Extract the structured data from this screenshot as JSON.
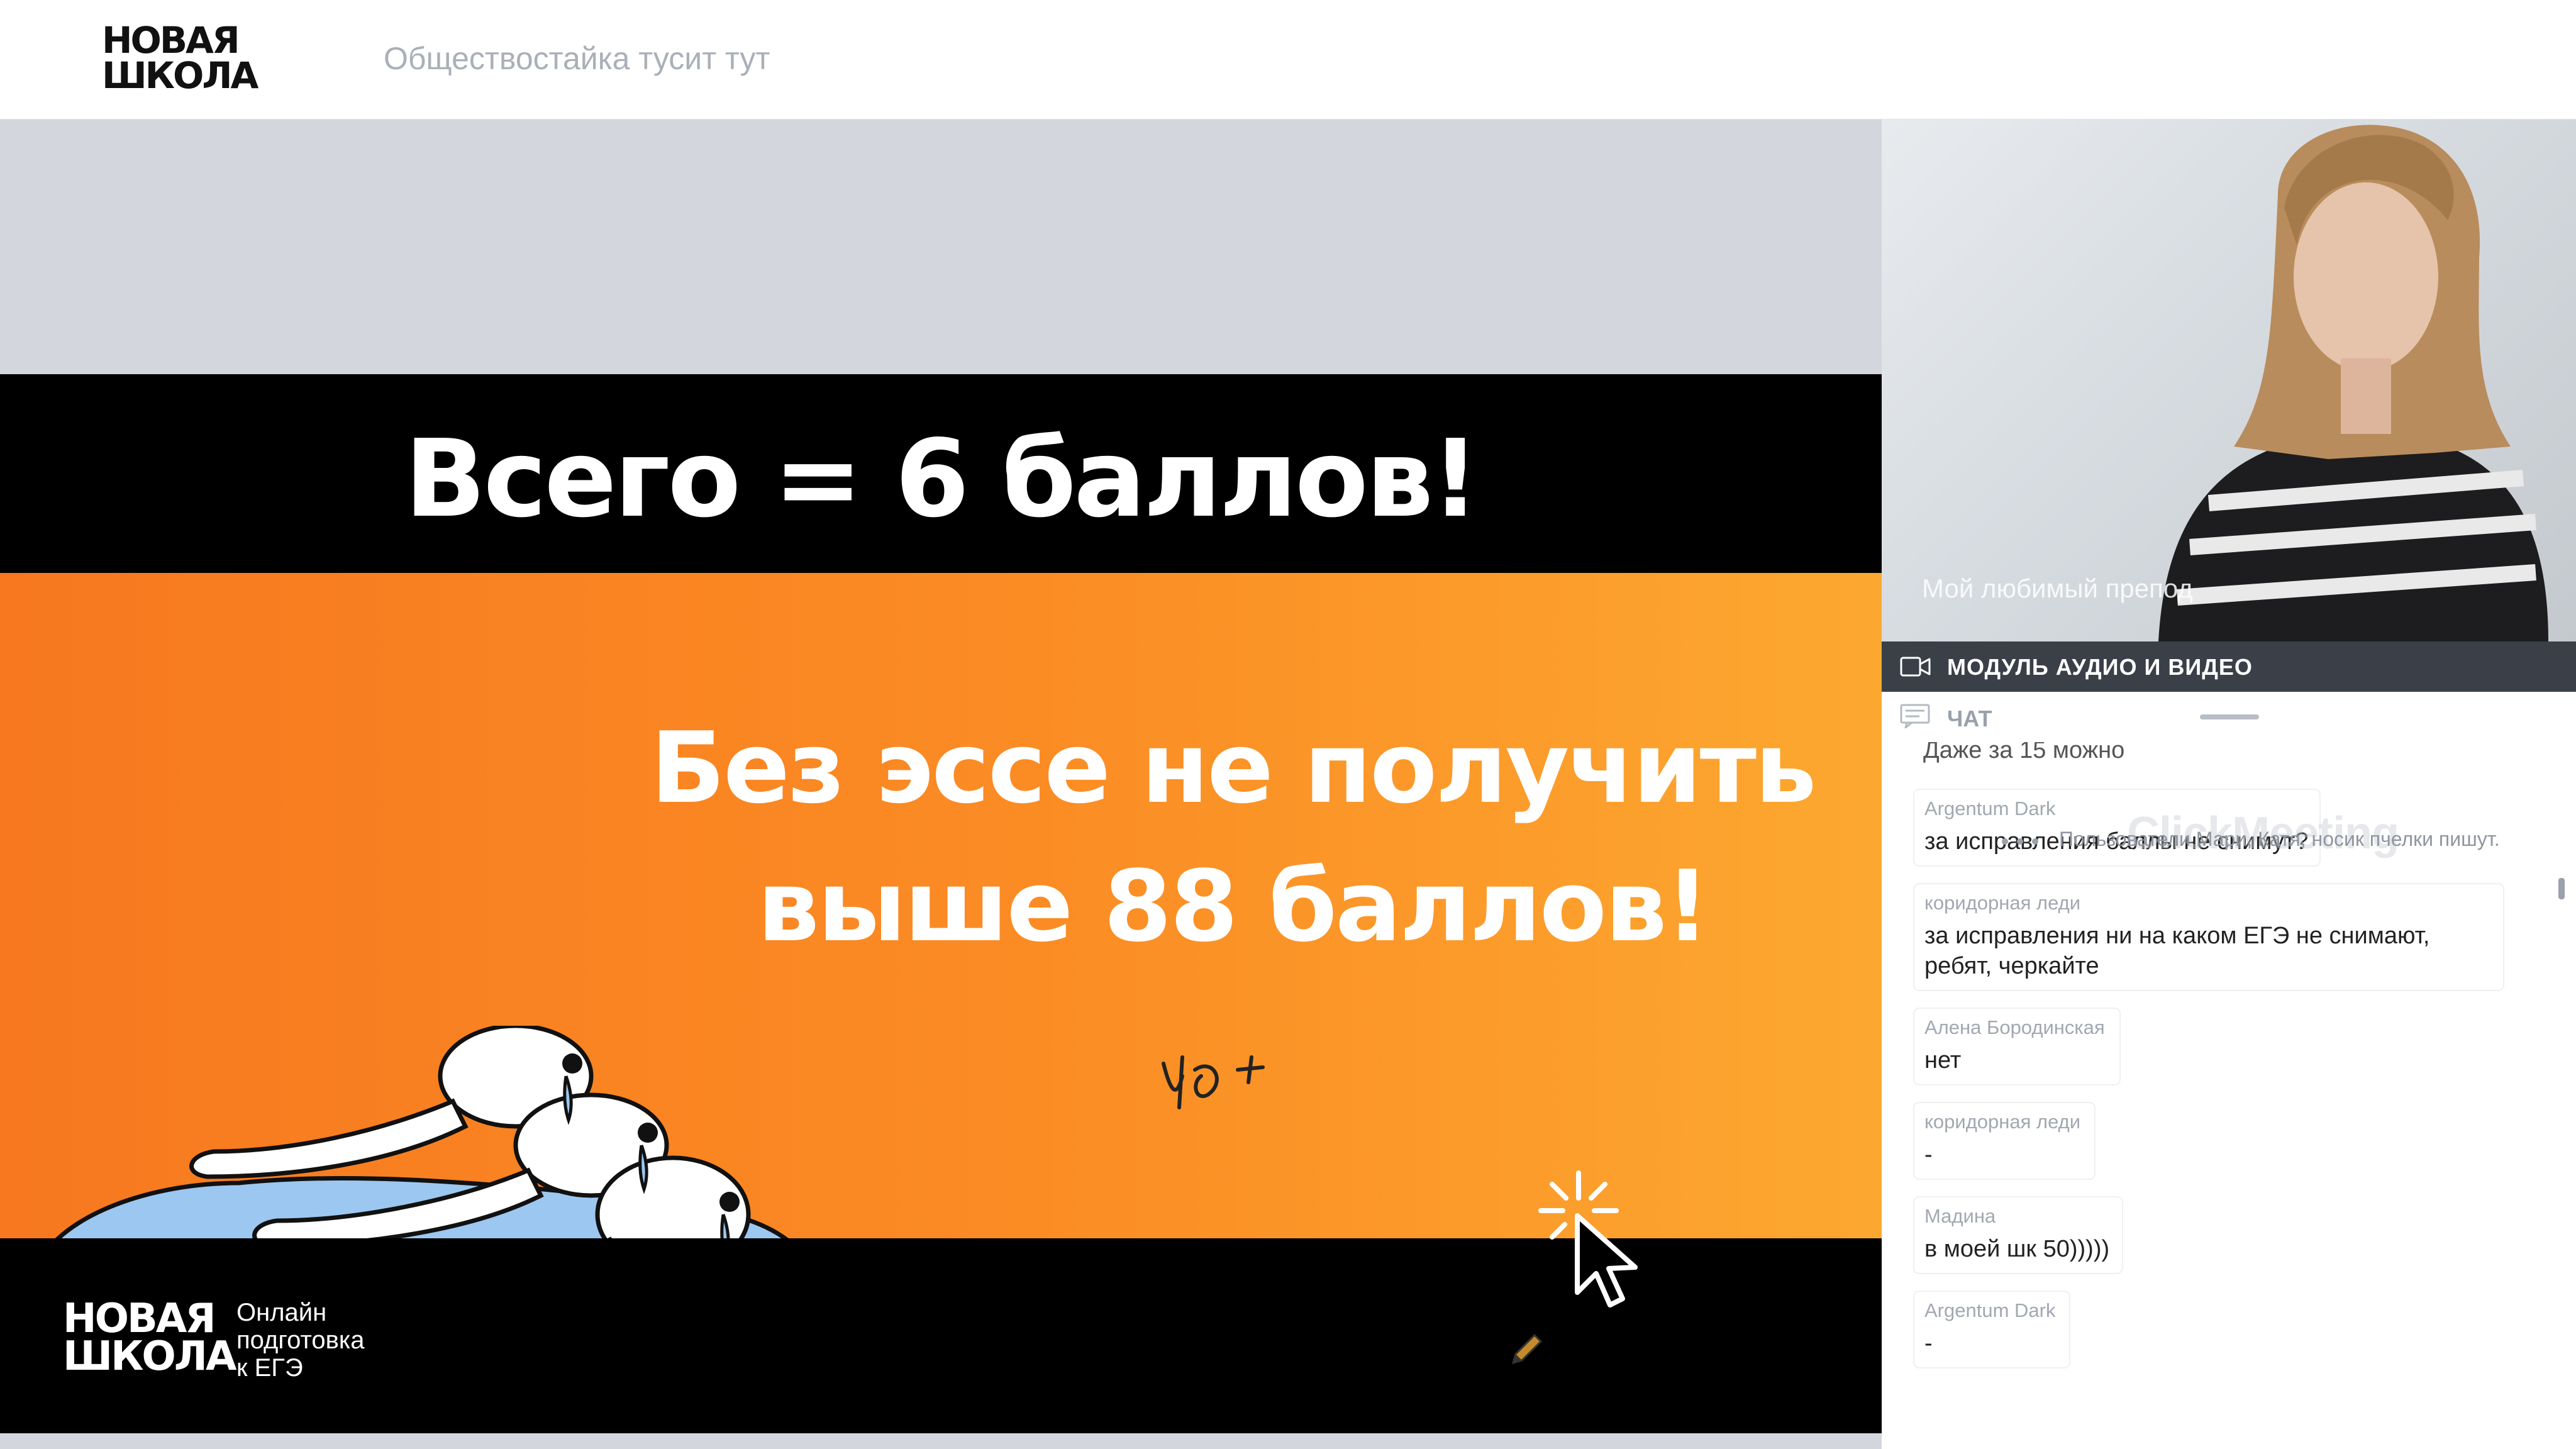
{
  "header": {
    "logo_line1": "НОВАЯ",
    "logo_line2": "ШКОЛА",
    "room_title": "Обществостайка тусит тут"
  },
  "slide": {
    "title": "Всего = 6 баллов!",
    "text_line1": "Без эссе не получить",
    "text_line2": "выше 88 баллов!",
    "logo_line1": "НОВАЯ",
    "logo_line2": "ШКОЛА",
    "tagline_line1": "Онлайн",
    "tagline_line2": "подготовка",
    "tagline_line3": "к ЕГЭ",
    "colors": {
      "orange": "#f7781f",
      "black": "#000000",
      "puddle": "#9cc7f0"
    }
  },
  "video": {
    "label": "Мой любимый препод"
  },
  "av_module": {
    "label": "МОДУЛЬ АУДИО И ВИДЕО",
    "icon": "video-camera-icon"
  },
  "chat": {
    "label": "ЧАТ",
    "icon": "chat-icon",
    "partial_message": "Даже за 15 можно",
    "messages": [
      {
        "author": "Argentum Dark",
        "text": "за исправления баллы не снимут?"
      },
      {
        "author": "коридорная леди",
        "text": "за исправления ни на каком ЕГЭ не снимают, ребят, черкайте"
      },
      {
        "author": "Алена Бородинская",
        "text": "нет"
      },
      {
        "author": "коридорная леди",
        "text": "-"
      },
      {
        "author": "Мадина",
        "text": "в моей шк 50)))))"
      },
      {
        "author": "Argentum Dark",
        "text": "-"
      }
    ],
    "typing_indicator": "Пользователи Мари, Катя, носик пчелки пишут.",
    "watermark": "ClickMeeting"
  }
}
